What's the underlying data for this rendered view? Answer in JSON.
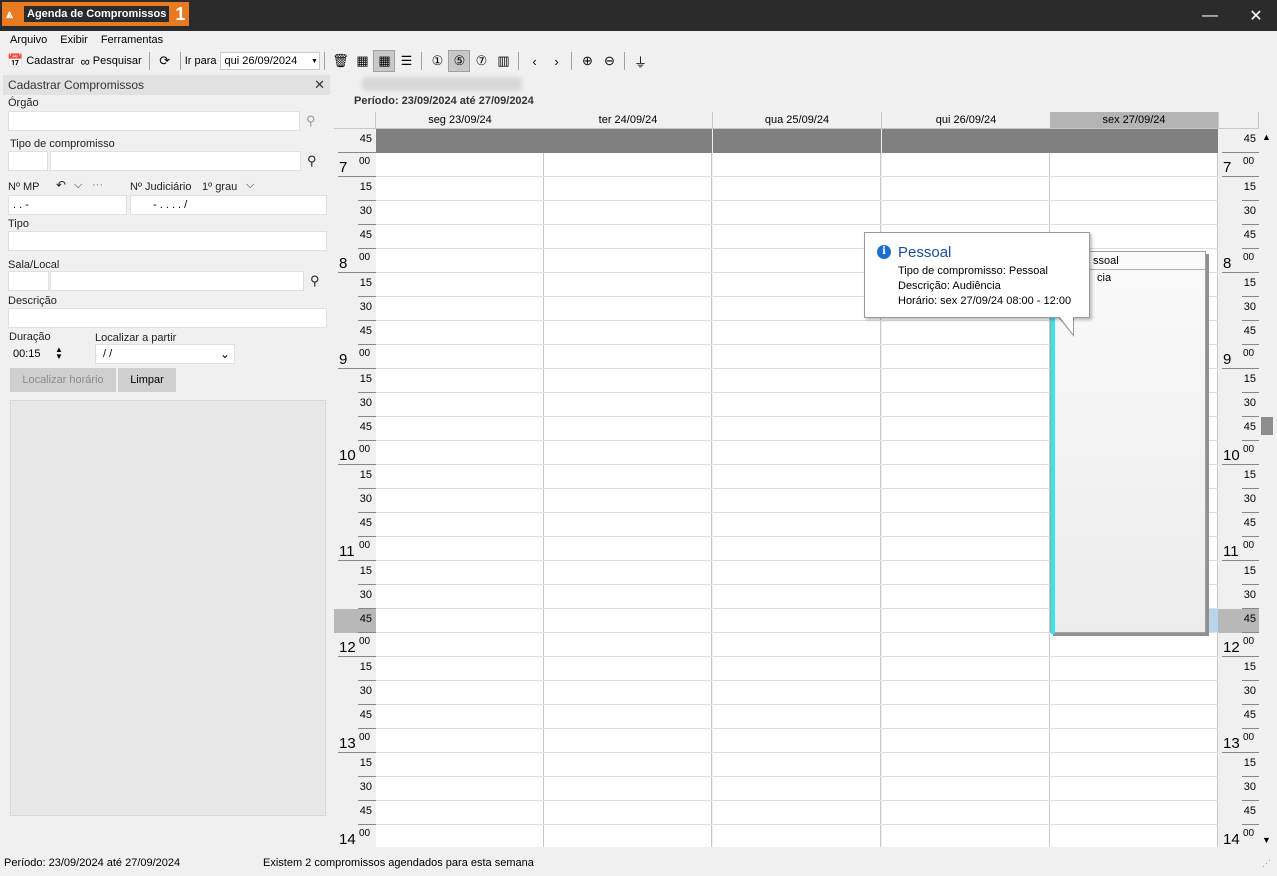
{
  "window": {
    "title": "Agenda de Compromissos",
    "badge": "1",
    "minimize": "—",
    "close": "✕"
  },
  "menu": [
    "Arquivo",
    "Exibir",
    "Ferramentas"
  ],
  "toolbar": {
    "cadastrar": "Cadastrar",
    "pesquisar": "Pesquisar",
    "ir_para": "Ir para",
    "date": "qui 26/09/2024"
  },
  "panel": {
    "title": "Cadastrar Compromissos",
    "orgao_label": "Órgão",
    "tipo_comp_label": "Tipo de compromisso",
    "nmp_label": "Nº MP",
    "nmp_value": ".   .      -",
    "njud_label": "Nº Judiciário",
    "grau": "1º grau",
    "njud_value": "-    .      .  .  .    /",
    "tipo_label": "Tipo",
    "sala_label": "Sala/Local",
    "descricao_label": "Descrição",
    "duracao_label": "Duração",
    "duracao_value": "00:15",
    "localizar_label": "Localizar a partir",
    "localizar_value": "/ /",
    "btn_localizar": "Localizar horário",
    "btn_limpar": "Limpar"
  },
  "calendar": {
    "period": "Período: 23/09/2024 até 27/09/2024",
    "days": [
      "seg 23/09/24",
      "ter 24/09/24",
      "qua 25/09/24",
      "qui 26/09/24",
      "sex 27/09/24"
    ],
    "selected_day": 4,
    "slots": [
      {
        "hour": "",
        "min": "45"
      },
      {
        "hour": "7",
        "min": "00"
      },
      {
        "hour": "",
        "min": "15"
      },
      {
        "hour": "",
        "min": "30"
      },
      {
        "hour": "",
        "min": "45"
      },
      {
        "hour": "8",
        "min": "00"
      },
      {
        "hour": "",
        "min": "15"
      },
      {
        "hour": "",
        "min": "30"
      },
      {
        "hour": "",
        "min": "45"
      },
      {
        "hour": "9",
        "min": "00"
      },
      {
        "hour": "",
        "min": "15"
      },
      {
        "hour": "",
        "min": "30"
      },
      {
        "hour": "",
        "min": "45"
      },
      {
        "hour": "10",
        "min": "00"
      },
      {
        "hour": "",
        "min": "15"
      },
      {
        "hour": "",
        "min": "30"
      },
      {
        "hour": "",
        "min": "45"
      },
      {
        "hour": "11",
        "min": "00"
      },
      {
        "hour": "",
        "min": "15"
      },
      {
        "hour": "",
        "min": "30"
      },
      {
        "hour": "",
        "min": "45"
      },
      {
        "hour": "12",
        "min": "00"
      },
      {
        "hour": "",
        "min": "15"
      },
      {
        "hour": "",
        "min": "30"
      },
      {
        "hour": "",
        "min": "45"
      },
      {
        "hour": "13",
        "min": "00"
      },
      {
        "hour": "",
        "min": "15"
      },
      {
        "hour": "",
        "min": "30"
      },
      {
        "hour": "",
        "min": "45"
      },
      {
        "hour": "14",
        "min": "00"
      }
    ],
    "appointment": {
      "header": "ssoal",
      "text": "cia"
    },
    "tooltip": {
      "title": "Pessoal",
      "line1": "Tipo de compromisso: Pessoal",
      "line2": "Descrição: Audiência",
      "line3": "Horário: sex 27/09/24 08:00 - 12:00"
    }
  },
  "status": {
    "period": "Período: 23/09/2024 até 27/09/2024",
    "message": "Existem 2 compromissos agendados para esta semana"
  }
}
